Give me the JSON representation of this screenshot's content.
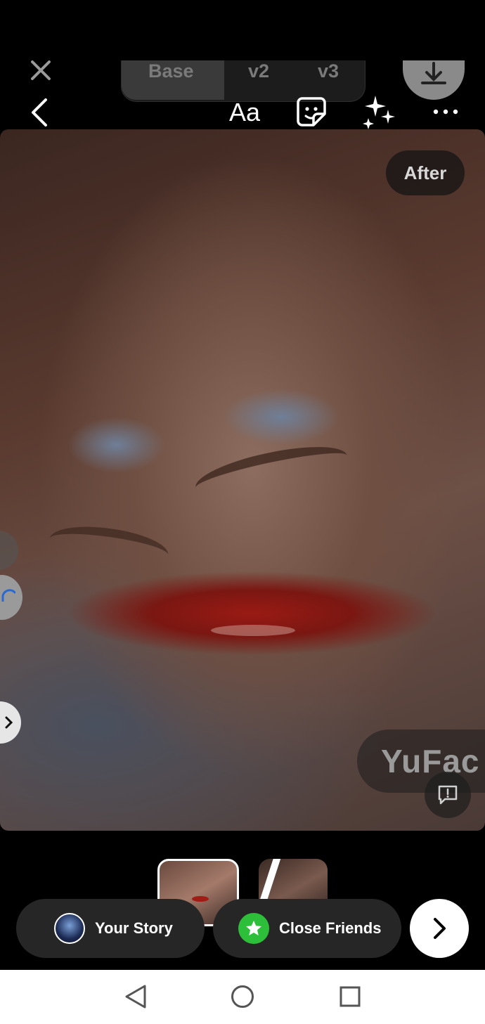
{
  "top_overlay": {
    "close_label": "Close",
    "versions": [
      "Base",
      "v2",
      "v3"
    ],
    "active_version": "Base"
  },
  "toolbar": {
    "text_tool_label": "Aa",
    "icons": [
      "back-icon",
      "sticker-icon",
      "effects-sparkle-icon",
      "more-icon"
    ]
  },
  "canvas": {
    "after_label": "After",
    "watermark": "YuFac"
  },
  "share": {
    "your_story_label": "Your Story",
    "close_friends_label": "Close Friends"
  },
  "colors": {
    "background": "#000000",
    "pill": "#262626",
    "close_friends_green": "#2dbf3a",
    "lips": "#9a1a14"
  },
  "android_nav": [
    "back",
    "home",
    "recents"
  ]
}
